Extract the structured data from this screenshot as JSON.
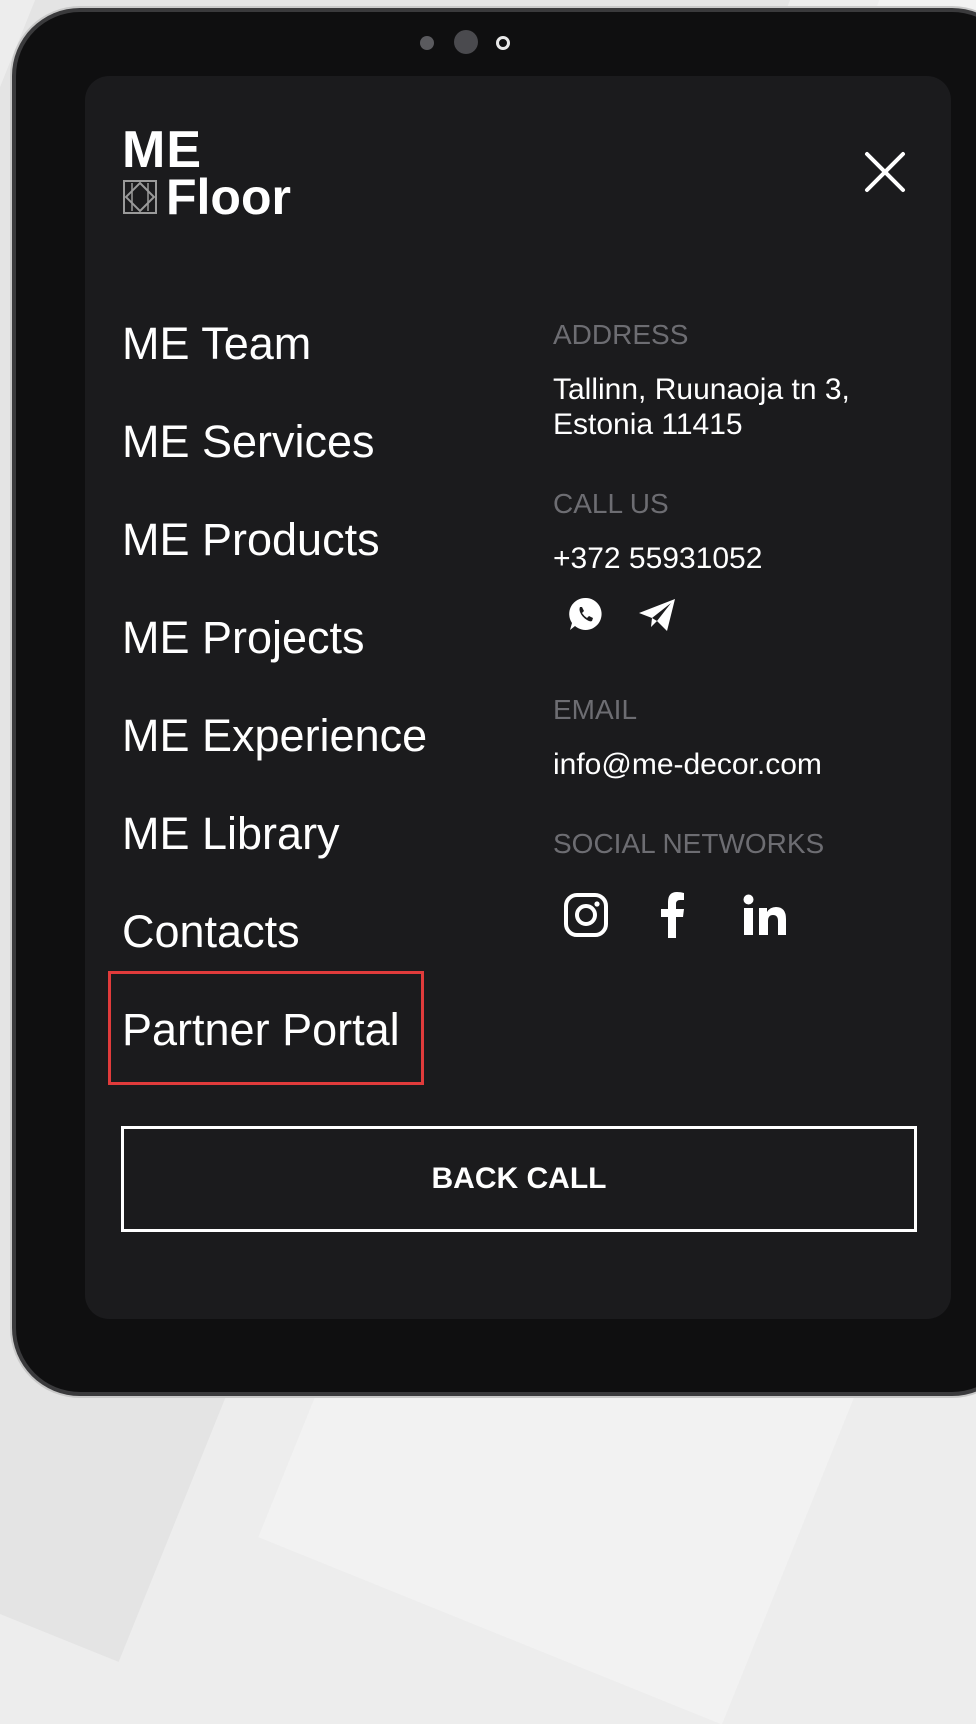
{
  "brand": {
    "line1": "ME",
    "line2": "Floor",
    "logo_icon": "floor-tile-logo-icon"
  },
  "menu": {
    "items": [
      {
        "label": "ME Team"
      },
      {
        "label": "ME Services"
      },
      {
        "label": "ME Products"
      },
      {
        "label": "ME Projects"
      },
      {
        "label": "ME Experience"
      },
      {
        "label": "ME Library"
      },
      {
        "label": "Contacts"
      },
      {
        "label": "Partner Portal",
        "highlighted": true
      }
    ],
    "close_icon": "close-icon"
  },
  "contact": {
    "address_label": "ADDRESS",
    "address_line1": "Tallinn, Ruunaoja tn 3,",
    "address_line2": "Estonia 11415",
    "call_label": "CALL US",
    "phone": "+372 55931052",
    "messengers": [
      "whatsapp-icon",
      "telegram-icon"
    ],
    "email_label": "EMAIL",
    "email": "info@me-decor.com",
    "social_label": "SOCIAL NETWORKS",
    "social": [
      "instagram-icon",
      "facebook-icon",
      "linkedin-icon"
    ]
  },
  "cta": {
    "label": "BACK CALL"
  },
  "colors": {
    "background": "#1b1b1d",
    "text": "#ffffff",
    "muted_label": "#6d6d72",
    "highlight": "#e13b3b"
  }
}
